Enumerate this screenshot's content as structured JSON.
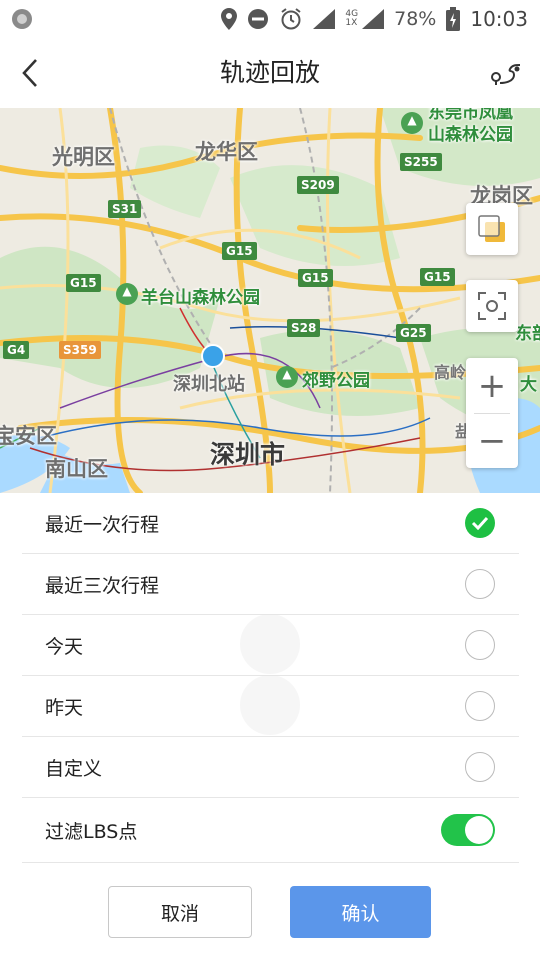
{
  "status_bar": {
    "network_top": "4G",
    "network_bottom": "1X",
    "battery": "78%",
    "time": "10:03",
    "icons": [
      "notification-dot-icon",
      "location-icon",
      "do-not-disturb-icon",
      "alarm-icon",
      "signal-icon",
      "battery-icon"
    ]
  },
  "header": {
    "title": "轨迹回放",
    "back_icon": "chevron-left-icon",
    "action_icon": "route-icon"
  },
  "map": {
    "places": {
      "guangming": "光明区",
      "longhua": "龙华区",
      "longgang": "龙岗区",
      "dongguan_park": "东莞市凤凰\n山森林公园",
      "dongbu": "东部",
      "yangtai": "羊台山森林公园",
      "shenzhen_north": "深圳北站",
      "jiaoye": "郊野公园",
      "gaoling": "高岭",
      "da": "大",
      "baoan": "宝安区",
      "nanshan": "南山区",
      "shenzhen": "深圳市",
      "yan": "盐"
    },
    "shields": {
      "s255": "S255",
      "s209": "S209",
      "s31": "S31",
      "g15_a": "G15",
      "g15_b": "G15",
      "g15_c": "G15",
      "g15_d": "G15",
      "s28": "S28",
      "g25": "G25",
      "g4": "G4",
      "s359": "S359"
    },
    "controls": {
      "layers_icon": "layers-icon",
      "locate_icon": "locate-icon",
      "zoom_in": "+",
      "zoom_out": "−"
    }
  },
  "options": [
    {
      "label": "最近一次行程",
      "checked": true
    },
    {
      "label": "最近三次行程",
      "checked": false
    },
    {
      "label": "今天",
      "checked": false
    },
    {
      "label": "昨天",
      "checked": false
    },
    {
      "label": "自定义",
      "checked": false
    }
  ],
  "filter": {
    "label": "过滤LBS点",
    "enabled": true
  },
  "buttons": {
    "cancel": "取消",
    "confirm": "确认"
  },
  "colors": {
    "accent_green": "#1ec043",
    "confirm_blue": "#5b96ea",
    "road_yellow": "#f6c54a"
  }
}
